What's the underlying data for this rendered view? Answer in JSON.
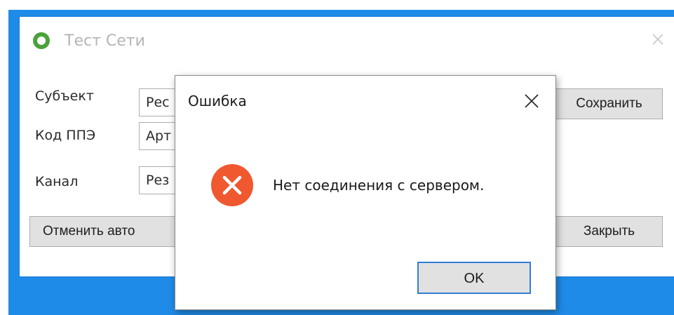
{
  "main_window": {
    "title": "Тест Сети",
    "fields": [
      {
        "label": "Субъект",
        "value": "Рес"
      },
      {
        "label": "Код ППЭ",
        "value": "Арт"
      },
      {
        "label": "Канал",
        "value": "Рез"
      }
    ],
    "buttons": {
      "save": "Сохранить",
      "cancel_auto": "Отменить авто",
      "close": "Закрыть"
    }
  },
  "dialog": {
    "title": "Ошибка",
    "message": "Нет соединения с сервером.",
    "ok_label": "OK"
  },
  "colors": {
    "desktop": "#1f8be8",
    "error_icon": "#f0582f",
    "app_icon": "#4aa23a",
    "focus_border": "#2f7fd6"
  },
  "icons": {
    "app": "app-logo-icon",
    "main_close": "close-icon",
    "dialog_close": "close-icon",
    "error": "error-x-circle-icon"
  }
}
